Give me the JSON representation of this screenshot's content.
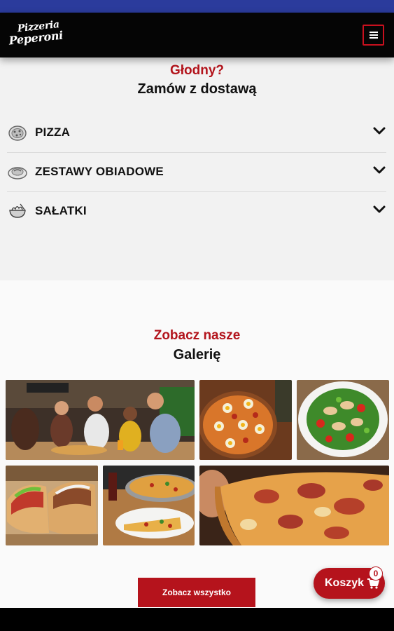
{
  "header": {
    "logo_line1": "Pizzeria",
    "logo_line2": "Peperoni",
    "menu_icon": "hamburger-menu-icon"
  },
  "order": {
    "kicker": "Głodny?",
    "title": "Zamów z dostawą",
    "categories": [
      {
        "label": "PIZZA",
        "icon": "pizza-icon"
      },
      {
        "label": "ZESTAWY OBIADOWE",
        "icon": "plate-icon"
      },
      {
        "label": "SAŁATKI",
        "icon": "salad-bowl-icon"
      }
    ]
  },
  "gallery": {
    "kicker": "Zobacz nasze",
    "title": "Galerię",
    "photos": [
      {
        "subject": "friends-eating-pizza-photo"
      },
      {
        "subject": "pizza-with-eggs-photo"
      },
      {
        "subject": "chicken-salad-photo"
      },
      {
        "subject": "pita-gyros-photo"
      },
      {
        "subject": "pizza-slice-on-plate-photo"
      },
      {
        "subject": "pizza-closeup-photo"
      }
    ],
    "see_all_label": "Zobacz wszystko"
  },
  "cart": {
    "label": "Koszyk",
    "count": "0",
    "icon": "cart-icon"
  },
  "colors": {
    "accent": "#b5131c",
    "header_bg": "#050505",
    "status_bar": "#2b3b9c",
    "section_bg": "#f2f2f2"
  }
}
